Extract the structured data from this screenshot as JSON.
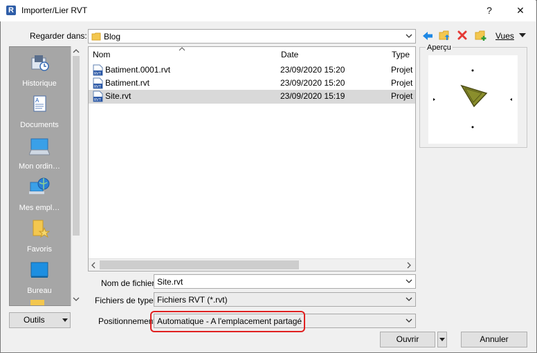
{
  "window": {
    "title": "Importer/Lier RVT",
    "help_label": "?",
    "close_label": "✕"
  },
  "look_in": {
    "label": "Regarder dans:",
    "value": "Blog"
  },
  "toolbar": {
    "views_label": "Vues"
  },
  "sidebar": {
    "items": [
      {
        "label": "Historique",
        "icon": "history-icon"
      },
      {
        "label": "Documents",
        "icon": "documents-icon"
      },
      {
        "label": "Mon ordin…",
        "icon": "computer-icon"
      },
      {
        "label": "Mes empl…",
        "icon": "network-icon"
      },
      {
        "label": "Favoris",
        "icon": "favorites-icon"
      },
      {
        "label": "Bureau",
        "icon": "desktop-icon"
      }
    ]
  },
  "file_list": {
    "columns": [
      "Nom",
      "Date",
      "Type"
    ],
    "rows": [
      {
        "name": "Batiment.0001.rvt",
        "date": "23/09/2020 15:20",
        "type": "Projet"
      },
      {
        "name": "Batiment.rvt",
        "date": "23/09/2020 15:20",
        "type": "Projet"
      },
      {
        "name": "Site.rvt",
        "date": "23/09/2020 15:19",
        "type": "Projet"
      }
    ]
  },
  "preview": {
    "label": "Aperçu"
  },
  "filename": {
    "label": "Nom de fichier:",
    "value": "Site.rvt"
  },
  "filetype": {
    "label": "Fichiers de type:",
    "value": "Fichiers RVT  (*.rvt)"
  },
  "positioning": {
    "label": "Positionnement:",
    "value": "Automatique - A l'emplacement partagé"
  },
  "buttons": {
    "tools": "Outils",
    "open": "Ouvrir",
    "cancel": "Annuler"
  },
  "colors": {
    "highlight": "#e02020",
    "selection": "#d9d9d9"
  }
}
